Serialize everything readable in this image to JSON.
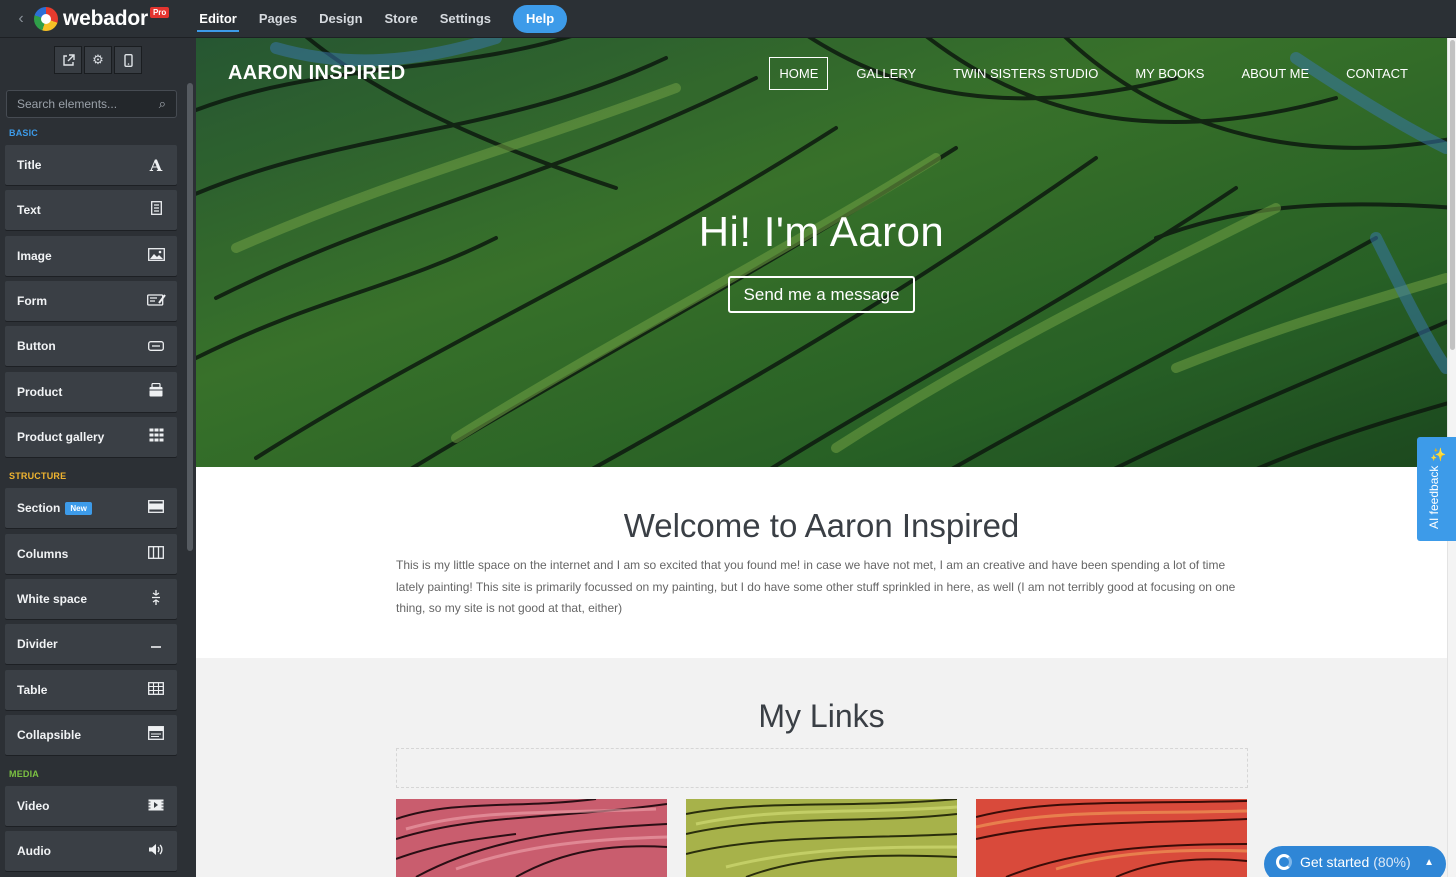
{
  "app": {
    "brand": "webador",
    "plan_badge": "Pro",
    "nav": [
      "Editor",
      "Pages",
      "Design",
      "Store",
      "Settings"
    ],
    "active_nav": "Editor",
    "help_label": "Help",
    "back_icon": "chevron-left-icon",
    "accent_color": "#3d9be9"
  },
  "sidebar": {
    "tools": [
      "external-link-icon",
      "gear-icon",
      "mobile-icon"
    ],
    "search_placeholder": "Search elements...",
    "categories": {
      "basic": {
        "label": "BASIC",
        "color": "#3d9be9"
      },
      "structure": {
        "label": "STRUCTURE",
        "color": "#f0b430"
      },
      "media": {
        "label": "MEDIA",
        "color": "#7cc242"
      }
    },
    "basic_items": [
      {
        "label": "Title",
        "icon": "title-icon"
      },
      {
        "label": "Text",
        "icon": "text-icon"
      },
      {
        "label": "Image",
        "icon": "image-icon"
      },
      {
        "label": "Form",
        "icon": "form-icon"
      },
      {
        "label": "Button",
        "icon": "button-icon"
      },
      {
        "label": "Product",
        "icon": "product-icon"
      },
      {
        "label": "Product gallery",
        "icon": "product-gallery-icon"
      }
    ],
    "structure_items": [
      {
        "label": "Section",
        "icon": "section-icon",
        "badge": "New"
      },
      {
        "label": "Columns",
        "icon": "columns-icon"
      },
      {
        "label": "White space",
        "icon": "white-space-icon"
      },
      {
        "label": "Divider",
        "icon": "divider-icon"
      },
      {
        "label": "Table",
        "icon": "table-icon"
      },
      {
        "label": "Collapsible",
        "icon": "collapsible-icon"
      }
    ],
    "media_items": [
      {
        "label": "Video",
        "icon": "video-icon"
      },
      {
        "label": "Audio",
        "icon": "audio-icon"
      }
    ]
  },
  "site": {
    "title": "AARON INSPIRED",
    "nav": [
      "HOME",
      "GALLERY",
      "TWIN SISTERS STUDIO",
      "MY BOOKS",
      "ABOUT ME",
      "CONTACT"
    ],
    "active_nav": "HOME",
    "hero_heading": "Hi! I'm Aaron",
    "hero_button": "Send me a message",
    "welcome_heading": "Welcome to Aaron Inspired",
    "welcome_text": "This is my little space on the internet and I am so excited that you found me! in case we have not met, I am an creative and have been spending a lot of time lately painting! This site is primarily focussed on my painting, but I do have some other stuff sprinkled in here, as well (I am not terribly good at focusing on one thing, so my site is not good at that, either)",
    "links_heading": "My Links"
  },
  "feedback_tab": {
    "label": "AI feedback",
    "icon": "magic-wand-icon"
  },
  "get_started": {
    "label": "Get started",
    "progress_text": "(80%)",
    "progress": 0.8,
    "icon": "progress-ring-icon",
    "caret_icon": "caret-up-icon"
  }
}
